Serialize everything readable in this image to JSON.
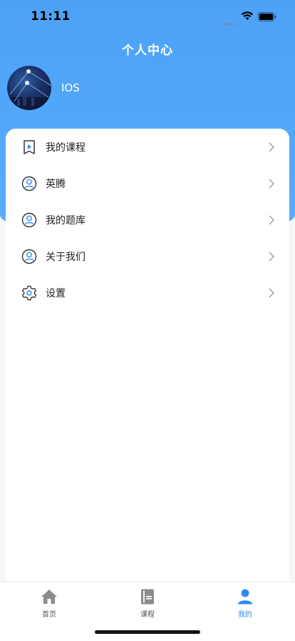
{
  "status_bar": {
    "time": "11:11"
  },
  "header": {
    "title": "个人中心"
  },
  "profile": {
    "username": "IOS"
  },
  "menu": {
    "items": [
      {
        "label": "我的课程",
        "icon": "course-play-icon"
      },
      {
        "label": "英腾",
        "icon": "user-circle-icon"
      },
      {
        "label": "我的题库",
        "icon": "user-circle-icon"
      },
      {
        "label": "关于我们",
        "icon": "user-circle-icon"
      },
      {
        "label": "设置",
        "icon": "gear-icon"
      }
    ]
  },
  "tab_bar": {
    "tabs": [
      {
        "label": "首页",
        "icon": "home-icon",
        "active": false
      },
      {
        "label": "课程",
        "icon": "book-icon",
        "active": false
      },
      {
        "label": "我的",
        "icon": "person-icon",
        "active": true
      }
    ]
  },
  "colors": {
    "accent": "#2d8cf0",
    "header": "#52a8f9"
  }
}
